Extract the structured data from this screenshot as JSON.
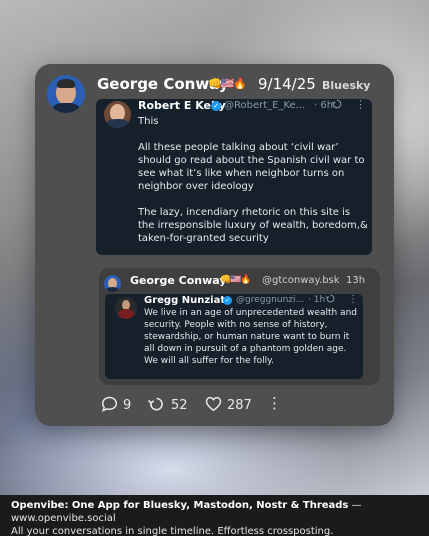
{
  "post": {
    "author": "George Conway",
    "emoji": "👊🇺🇸🔥",
    "date": "9/14/25",
    "network": "Bluesky"
  },
  "quote1": {
    "author": "Robert E Kelly",
    "handle": "@Robert_E_Ke...",
    "time": "· 6h",
    "text": "This\n\nAll these people talking about ‘civil war’ should go read about the Spanish civil war to see what it’s like when neighbor turns on neighbor over ideology\n\nThe lazy, incendiary rhetoric on this site is the irresponsible luxury of wealth, boredom,& taken-for-granted security"
  },
  "inner": {
    "author": "George Conway",
    "emoji": "👊🇺🇸🔥",
    "handle": "@gtconway.bsk",
    "time": "13h"
  },
  "quote2": {
    "author": "Gregg Nunziata",
    "handle": "@greggnunzi...",
    "time": "· 1h",
    "text": "We live in an age of unprecedented wealth and security. People with no sense of history, stewardship, or human nature want to burn it all down in pursuit of a phantom golden age. We will all suffer for the folly."
  },
  "actions": {
    "replies": "9",
    "reposts": "52",
    "likes": "287"
  },
  "footer": {
    "headline": "Openvibe: One App for Bluesky, Mastodon, Nostr & Threads",
    "url": " — www.openvibe.social",
    "tagline": "All your conversations in single timeline. Effortless crossposting."
  },
  "icons": {
    "verified": "verified-badge-icon",
    "repost_small": "repost-icon",
    "more": "more-icon",
    "reply": "reply-icon",
    "repost": "repost-icon",
    "like": "heart-icon"
  },
  "colors": {
    "card": "#4f4f50",
    "quote_bg": "#15202b",
    "verified": "#1d9bf0",
    "muted": "#8b98a5"
  }
}
